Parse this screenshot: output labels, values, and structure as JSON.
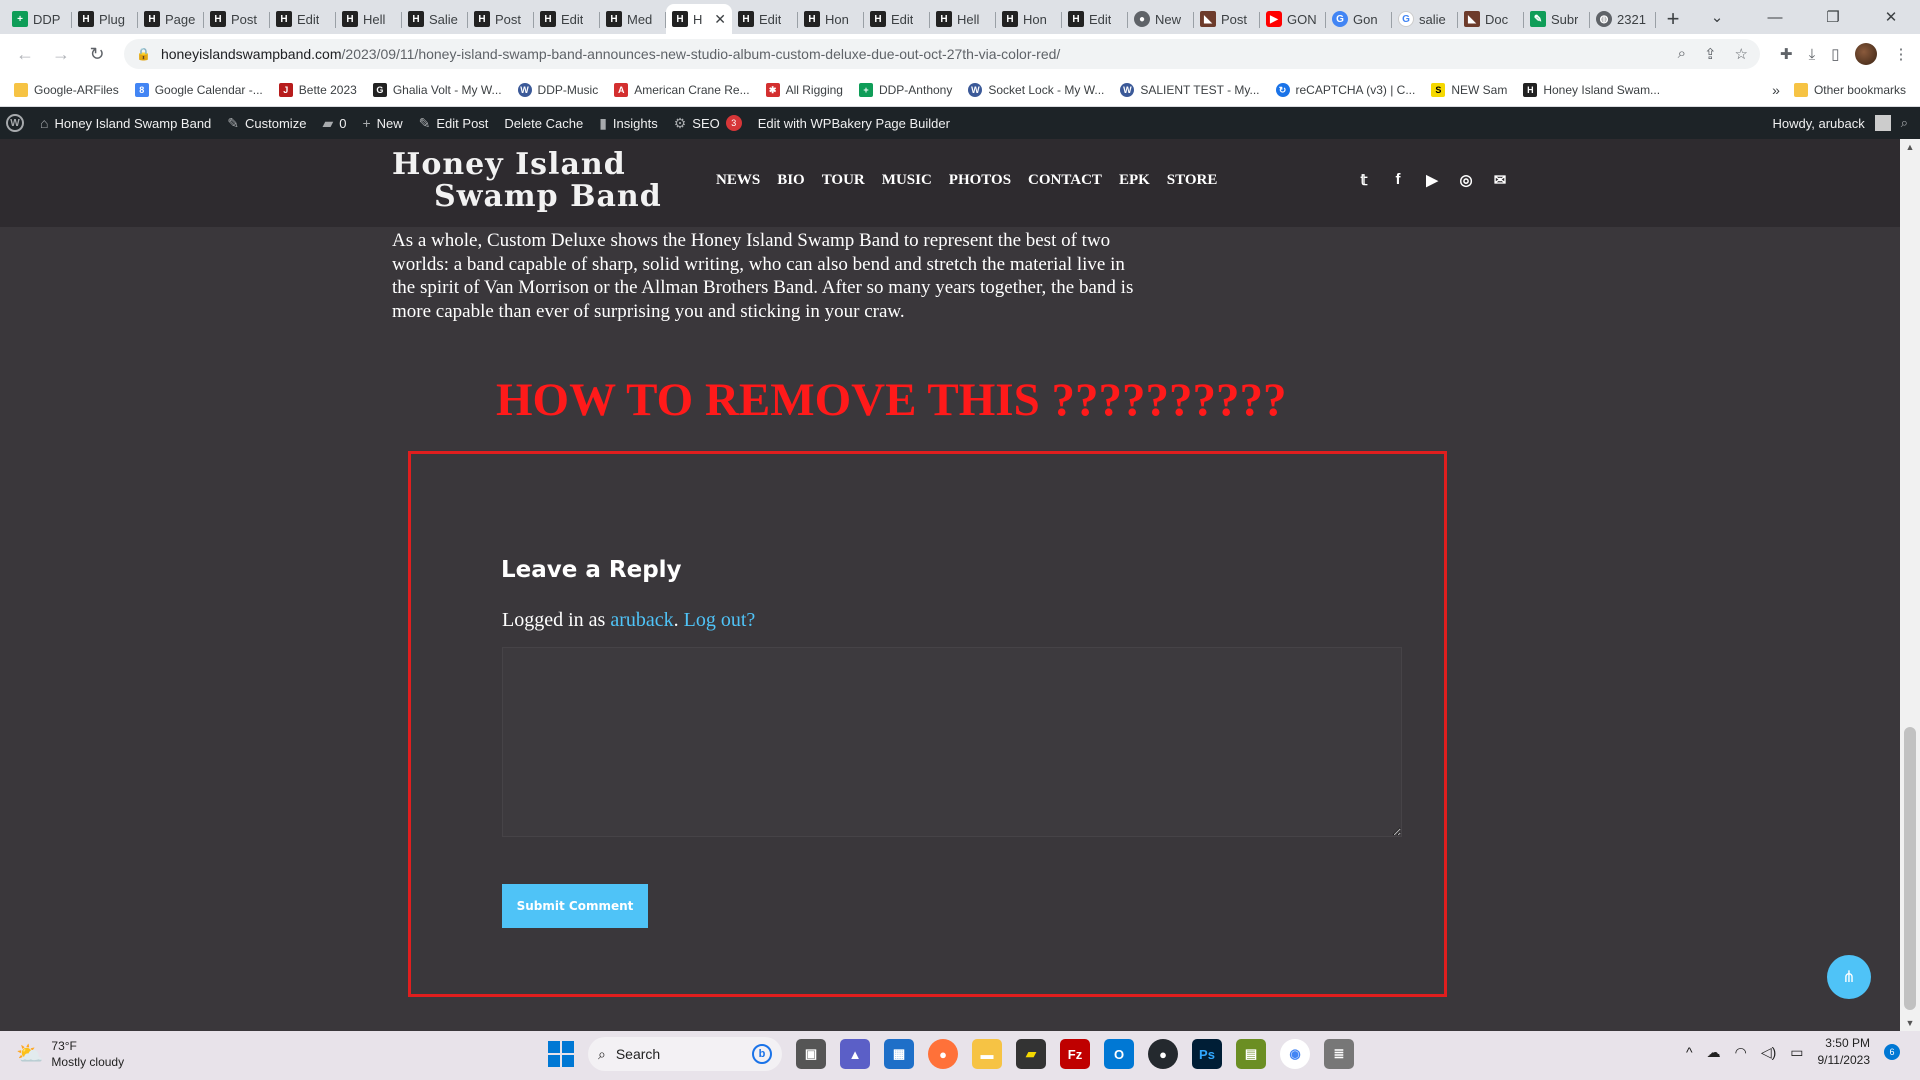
{
  "browser": {
    "tabs": [
      {
        "label": "DDP",
        "icon": "green-sheet-icon",
        "cls": "green",
        "glyph": "+"
      },
      {
        "label": "Plug",
        "icon": "hisb-logo-icon",
        "cls": "dark",
        "glyph": "H"
      },
      {
        "label": "Page",
        "icon": "hisb-logo-icon",
        "cls": "dark",
        "glyph": "H"
      },
      {
        "label": "Post",
        "icon": "hisb-logo-icon",
        "cls": "dark",
        "glyph": "H"
      },
      {
        "label": "Edit",
        "icon": "hisb-logo-icon",
        "cls": "dark",
        "glyph": "H"
      },
      {
        "label": "Hell",
        "icon": "hisb-logo-icon",
        "cls": "dark",
        "glyph": "H"
      },
      {
        "label": "Salie",
        "icon": "hisb-logo-icon",
        "cls": "dark",
        "glyph": "H"
      },
      {
        "label": "Post",
        "icon": "hisb-logo-icon",
        "cls": "dark",
        "glyph": "H"
      },
      {
        "label": "Edit",
        "icon": "hisb-logo-icon",
        "cls": "dark",
        "glyph": "H"
      },
      {
        "label": "Med",
        "icon": "hisb-logo-icon",
        "cls": "dark",
        "glyph": "H"
      },
      {
        "label": "H",
        "icon": "hisb-logo-icon",
        "cls": "dark",
        "glyph": "H",
        "active": true
      },
      {
        "label": "Edit",
        "icon": "hisb-logo-icon",
        "cls": "dark",
        "glyph": "H"
      },
      {
        "label": "Hon",
        "icon": "hisb-logo-icon",
        "cls": "dark",
        "glyph": "H"
      },
      {
        "label": "Edit",
        "icon": "hisb-logo-icon",
        "cls": "dark",
        "glyph": "H"
      },
      {
        "label": "Hell",
        "icon": "hisb-logo-icon",
        "cls": "dark",
        "glyph": "H"
      },
      {
        "label": "Hon",
        "icon": "hisb-logo-icon",
        "cls": "dark",
        "glyph": "H"
      },
      {
        "label": "Edit",
        "icon": "hisb-logo-icon",
        "cls": "dark",
        "glyph": "H"
      },
      {
        "label": "New",
        "icon": "github-icon",
        "cls": "glob",
        "glyph": "●"
      },
      {
        "label": "Post",
        "icon": "brown-icon",
        "cls": "brown",
        "glyph": "◣"
      },
      {
        "label": "GON",
        "icon": "youtube-icon",
        "cls": "red",
        "glyph": "▶"
      },
      {
        "label": "Gon",
        "icon": "blue-circle-icon",
        "cls": "blue",
        "glyph": "G"
      },
      {
        "label": "salie",
        "icon": "google-icon",
        "cls": "g",
        "glyph": "G"
      },
      {
        "label": "Doc",
        "icon": "brown-icon",
        "cls": "brown",
        "glyph": "◣"
      },
      {
        "label": "Subr",
        "icon": "green-pen-icon",
        "cls": "green",
        "glyph": "✎"
      },
      {
        "label": "2321",
        "icon": "globe-icon",
        "cls": "glob",
        "glyph": "◍"
      }
    ],
    "url_host": "honeyislandswampband.com",
    "url_path": "/2023/09/11/honey-island-swamp-band-announces-new-studio-album-custom-deluxe-due-out-oct-27th-via-color-red/"
  },
  "bookmarks": [
    {
      "label": "Google-ARFiles",
      "cls": "folder",
      "glyph": ""
    },
    {
      "label": "Google Calendar -...",
      "cls": "cal",
      "glyph": "8"
    },
    {
      "label": "Bette 2023",
      "cls": "redb",
      "glyph": "J"
    },
    {
      "label": "Ghalia Volt - My W...",
      "cls": "dark",
      "glyph": "G"
    },
    {
      "label": "DDP-Music",
      "cls": "wp",
      "glyph": "W"
    },
    {
      "label": "American Crane Re...",
      "cls": "crane",
      "glyph": "A"
    },
    {
      "label": "All Rigging",
      "cls": "crane",
      "glyph": "✱"
    },
    {
      "label": "DDP-Anthony",
      "cls": "green",
      "glyph": "+"
    },
    {
      "label": "Socket Lock - My W...",
      "cls": "wp",
      "glyph": "W"
    },
    {
      "label": "SALIENT TEST - My...",
      "cls": "wp",
      "glyph": "W"
    },
    {
      "label": "reCAPTCHA (v3) | C...",
      "cls": "cap",
      "glyph": "↻"
    },
    {
      "label": "NEW Sam",
      "cls": "yellow",
      "glyph": "S"
    },
    {
      "label": "Honey Island Swam...",
      "cls": "dark",
      "glyph": "H"
    }
  ],
  "bookmarks_other": "Other bookmarks",
  "adminbar": {
    "site": "Honey Island Swamp Band",
    "customize": "Customize",
    "comments": "0",
    "new": "New",
    "edit_post": "Edit Post",
    "delete_cache": "Delete Cache",
    "insights": "Insights",
    "seo": "SEO",
    "seo_count": "3",
    "wpbakery": "Edit with WPBakery Page Builder",
    "howdy": "Howdy, aruback"
  },
  "header": {
    "logo_line1": "Honey Island",
    "logo_line2": "Swamp Band",
    "nav": [
      "NEWS",
      "BIO",
      "TOUR",
      "MUSIC",
      "PHOTOS",
      "CONTACT",
      "EPK",
      "STORE"
    ]
  },
  "article": {
    "paragraph": "As a whole, Custom Deluxe shows the Honey Island Swamp Band to represent the best of two worlds: a band capable of sharp, solid writing, who can also bend and stretch the material live in the spirit of Van Morrison or the Allman Brothers Band. After so many years together, the band is more capable than ever of surprising you and sticking in your craw."
  },
  "annotation": "HOW TO REMOVE THIS ??????????",
  "reply": {
    "title": "Leave a Reply",
    "logged_prefix": "Logged in as ",
    "user": "aruback",
    "separator": ".",
    "logout": "Log out?",
    "comment_value": "",
    "submit": "Submit Comment"
  },
  "taskbar": {
    "temp": "73°F",
    "condition": "Mostly cloudy",
    "search": "Search",
    "time": "3:50 PM",
    "date": "9/11/2023",
    "notif_count": "6"
  },
  "colors": {
    "accent": "#4fc3f7",
    "annotation_red": "#e01e1e",
    "page_bg": "#3a373b",
    "header_bg": "#2e2b2f",
    "adminbar_bg": "#1d2327"
  }
}
